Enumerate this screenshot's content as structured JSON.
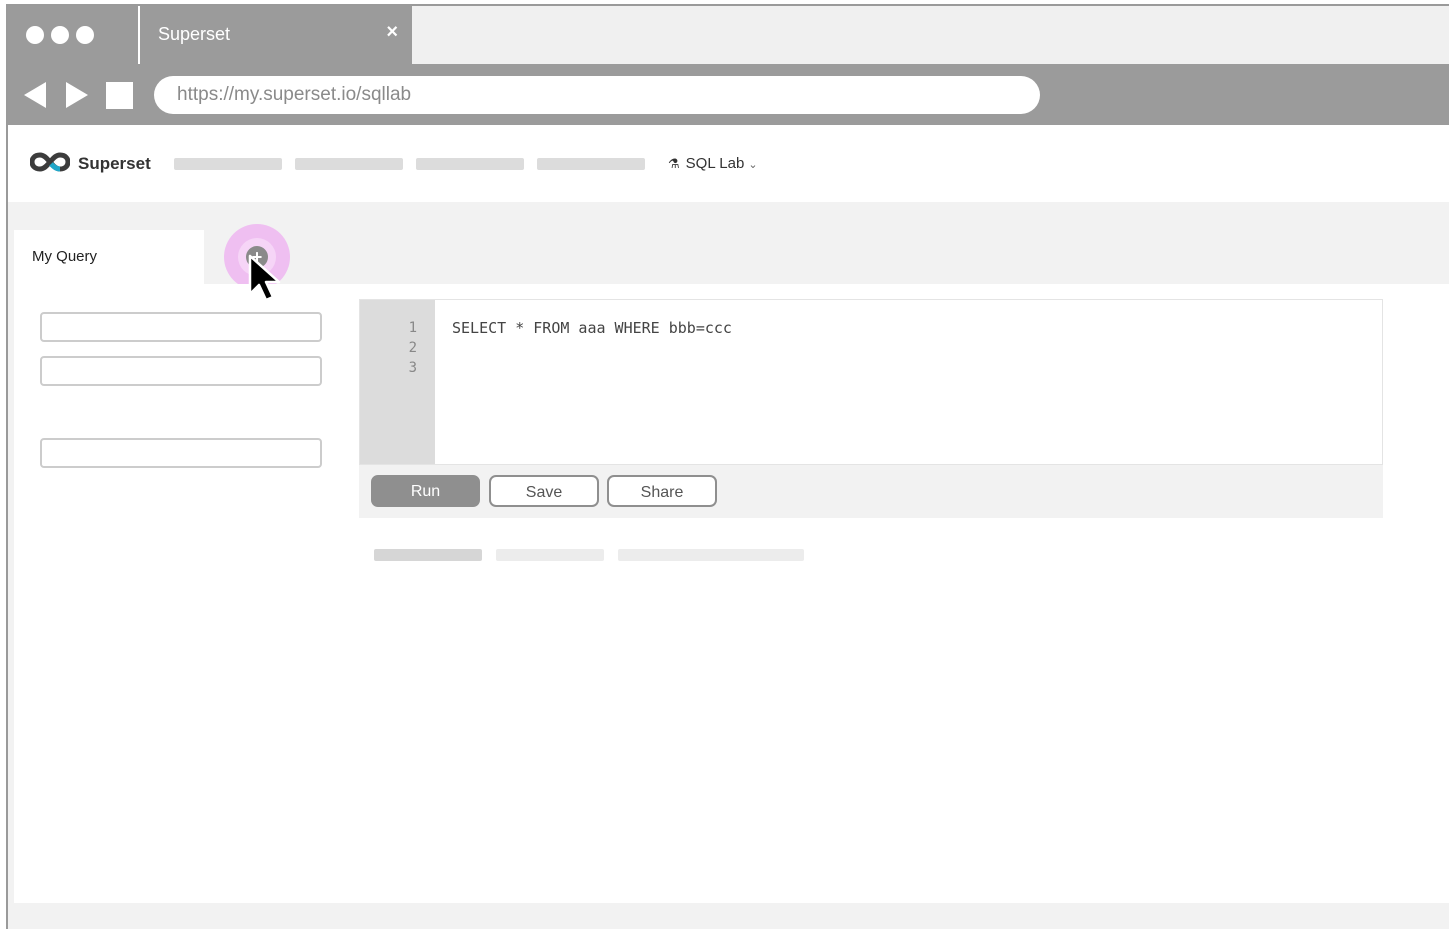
{
  "browser": {
    "tab_title": "Superset",
    "tab_close": "×",
    "url": "https://my.superset.io/sqllab"
  },
  "app": {
    "brand": "Superset",
    "sqllab_menu": "SQL Lab",
    "flask_glyph": "⚗",
    "chevron_glyph": "⌄"
  },
  "query_tabs": {
    "active_label": "My Query",
    "add_glyph": "+"
  },
  "editor": {
    "line_numbers": [
      "1",
      "2",
      "3"
    ],
    "code_line_1": "SELECT * FROM aaa WHERE bbb=ccc"
  },
  "toolbar": {
    "run_label": "Run",
    "save_label": "Save",
    "share_label": "Share"
  },
  "colors": {
    "chrome_gray": "#9b9b9b",
    "add_tab_highlight": "#ec96f0",
    "logo_accent": "#20a7c9"
  }
}
